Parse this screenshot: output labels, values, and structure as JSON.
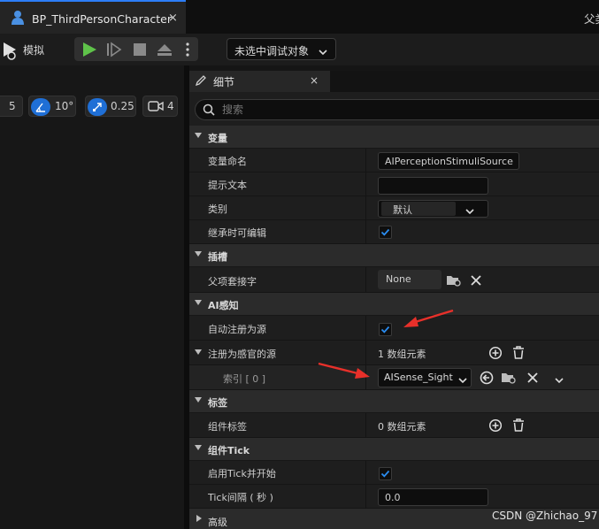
{
  "window": {
    "tab_title": "BP_ThirdPersonCharacter",
    "tab_close": "×",
    "right_title": "父类"
  },
  "toolbar": {
    "simulate_label": "模拟",
    "debug_select_value": "未选中调试对象"
  },
  "viewport_toolbar": {
    "grid_value": "5",
    "angle_value": "10°",
    "scale_value": "0.25",
    "camera_speed": "4"
  },
  "details": {
    "tab_label": "细节",
    "tab_close": "×",
    "search_placeholder": "搜索",
    "categories": {
      "variable": "变量",
      "socket": "插槽",
      "ai_perception": "AI感知",
      "tags": "标签",
      "component_tick": "组件Tick",
      "advanced": "高级"
    },
    "rows": {
      "variable_name_label": "变量命名",
      "variable_name_value": "AIPerceptionStimuliSource",
      "tooltip_label": "提示文本",
      "tooltip_value": "",
      "category_label": "类别",
      "category_value": "默认",
      "instance_editable_label": "继承时可编辑",
      "instance_editable_checked": true,
      "parent_socket_label": "父项套接字",
      "parent_socket_value": "None",
      "auto_register_label": "自动注册为源",
      "auto_register_checked": true,
      "register_sense_label": "注册为感官的源",
      "register_sense_count": "1 数组元素",
      "index_label": "索引 [ 0 ]",
      "index_value": "AISense_Sight",
      "component_tags_label": "组件标签",
      "component_tags_count": "0 数组元素",
      "start_with_tick_label": "启用Tick并开始",
      "start_with_tick_checked": true,
      "tick_interval_label": "Tick间隔 ( 秒 )",
      "tick_interval_value": "0.0"
    }
  },
  "watermark": "CSDN @Zhichao_97",
  "colors": {
    "accent_blue": "#1f6fd6",
    "play_green": "#5fc34a",
    "annotation_red": "#e8302a",
    "check_blue": "#2a8cf0"
  }
}
